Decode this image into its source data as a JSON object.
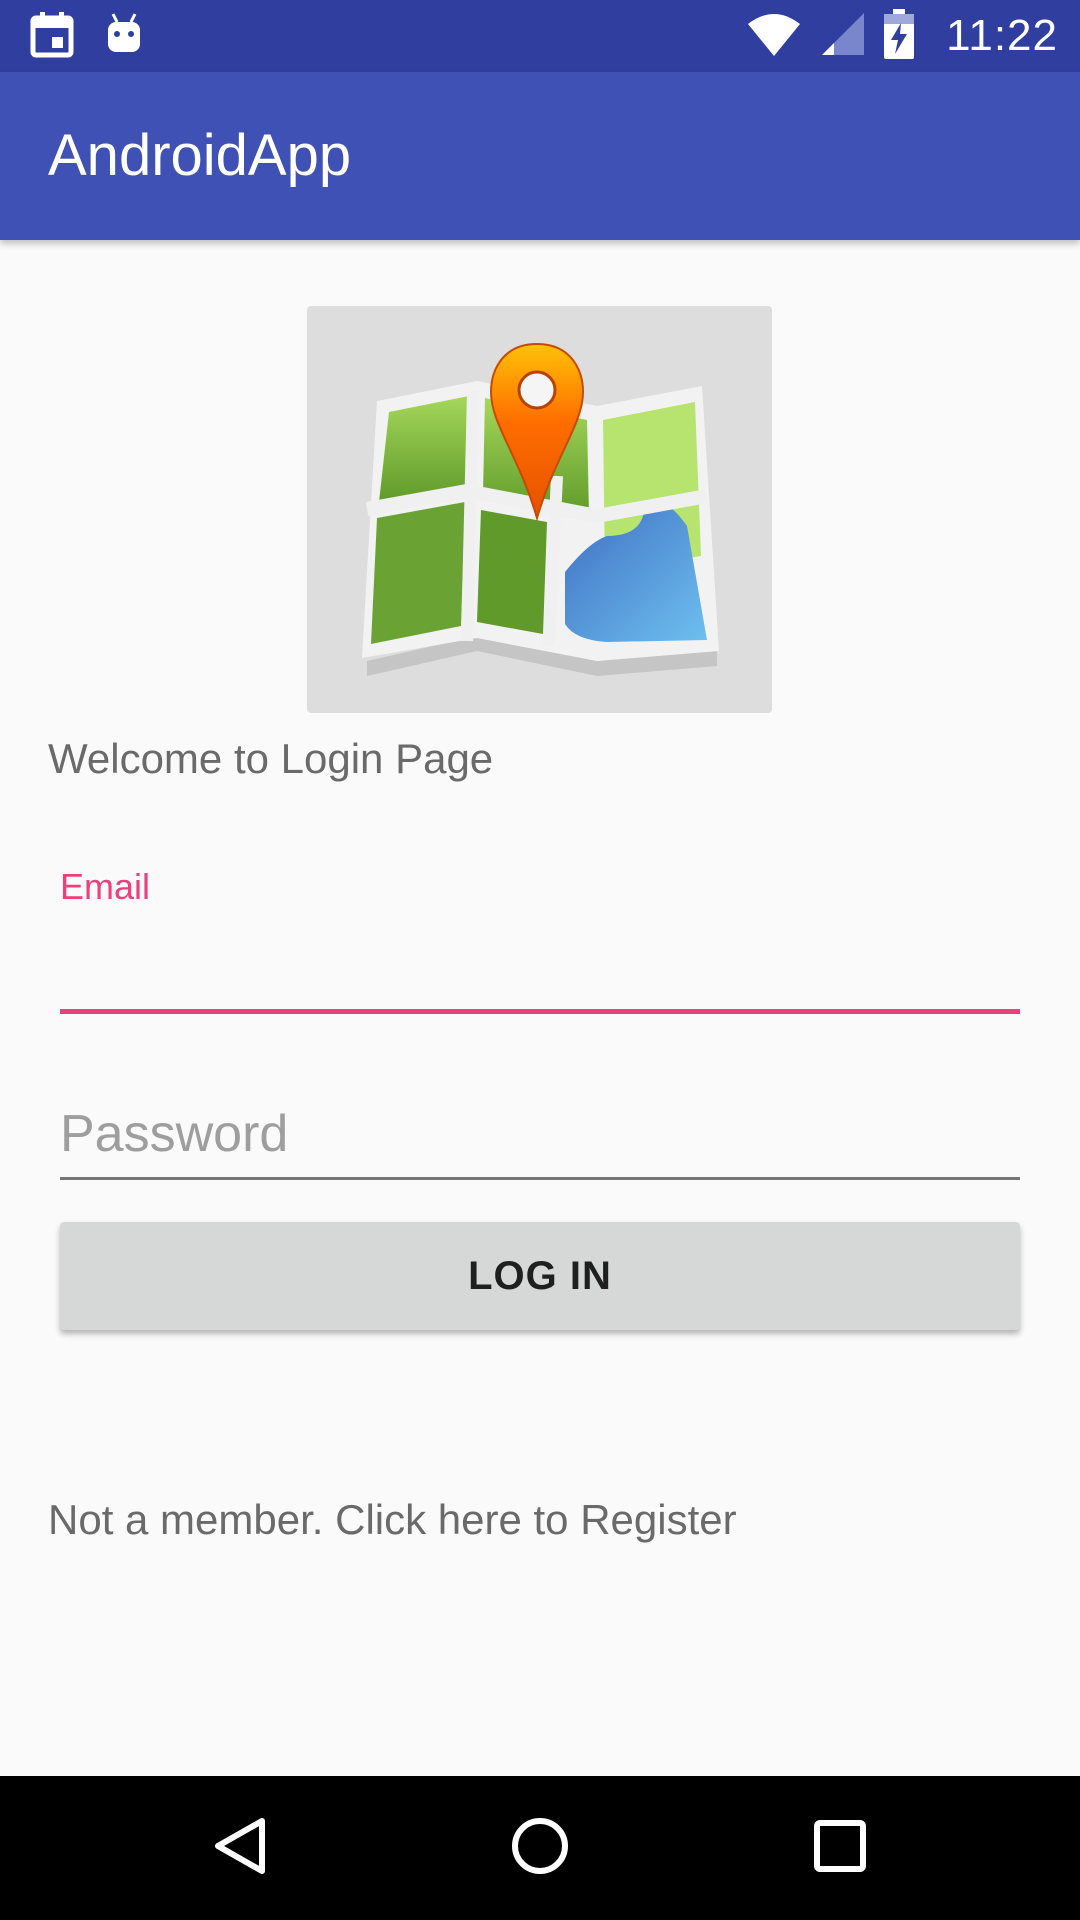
{
  "status_bar": {
    "time": "11:22",
    "icons": [
      "calendar-icon",
      "android-icon",
      "wifi-icon",
      "signal-icon",
      "battery-charging-icon"
    ],
    "color": "#303f9f"
  },
  "app_bar": {
    "title": "AndroidApp",
    "color": "#3f51b5"
  },
  "main": {
    "map_image": "map-icon",
    "welcome_text": "Welcome to Login Page",
    "email": {
      "label": "Email",
      "value": "",
      "accent_color": "#ec407a"
    },
    "password": {
      "placeholder": "Password",
      "value": ""
    },
    "login_button_label": "LOG IN",
    "register_text": "Not a member. Click here to Register"
  },
  "nav_bar": {
    "icons": [
      "back-icon",
      "home-icon",
      "recents-icon"
    ]
  }
}
